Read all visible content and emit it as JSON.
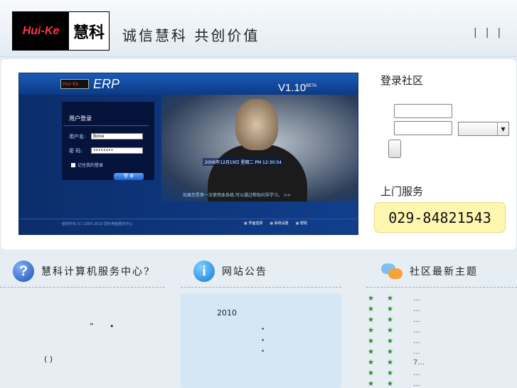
{
  "header": {
    "logo_en": "Hui-Ke",
    "logo_cn": "慧科",
    "slogan": "诚信慧科 共创价值",
    "top_links": [
      "|",
      "|",
      "|"
    ]
  },
  "banner": {
    "erp": "ERP",
    "version": "V1.10",
    "version_tag": "BETA",
    "login_title": "用户登录",
    "user_label": "用户名:",
    "user_value": "Bone",
    "pass_label": "密  码:",
    "pass_value": "••••••••",
    "remember": "记住我的登录",
    "login_btn": "登 录",
    "datetime": "2006年12月19日 星期二 PM 12:30:54",
    "hint": "如果您是第一次使用本系统,可以通过帮助向导学习。 >>",
    "copyright": "版权所有 (C) 2005-2010 慧科电脑服务中心",
    "tools": [
      "界面选择",
      "系统设置",
      "帮助"
    ]
  },
  "login": {
    "title": "登录社区"
  },
  "service": {
    "title": "上门服务",
    "phone": "029-84821543"
  },
  "sections": {
    "center": "慧科计算机服务中心?",
    "notice": "网站公告",
    "topics": "社区最新主题"
  },
  "center_text": {
    "a": "”",
    "b": "•",
    "c": "(   )"
  },
  "notice": {
    "year": "2010",
    "dots": [
      "•",
      "•",
      "•"
    ]
  },
  "topics": [
    {
      "s1": "★",
      "s2": "★",
      "text": "..."
    },
    {
      "s1": "★",
      "s2": "★",
      "text": "..."
    },
    {
      "s1": "★",
      "s2": "★",
      "text": "..."
    },
    {
      "s1": "★",
      "s2": "★",
      "text": "..."
    },
    {
      "s1": "★",
      "s2": "★",
      "text": "..."
    },
    {
      "s1": "★",
      "s2": "★",
      "text": "..."
    },
    {
      "s1": "★",
      "s2": "★",
      "text": "7..."
    },
    {
      "s1": "★",
      "s2": "★",
      "text": "..."
    },
    {
      "s1": "★",
      "s2": "★",
      "text": "..."
    },
    {
      "s1": "★",
      "s2": "★",
      "text": "..."
    }
  ]
}
